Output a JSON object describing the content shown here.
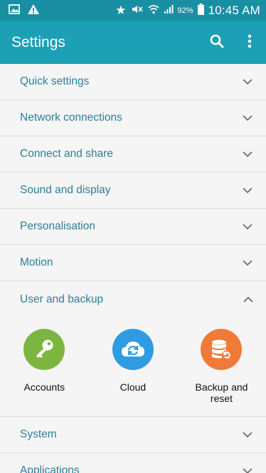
{
  "status_bar": {
    "battery_percent": "92%",
    "time": "10:45 AM"
  },
  "app_bar": {
    "title": "Settings",
    "search_icon": "search-icon",
    "more_icon": "more-vert-icon"
  },
  "settings": {
    "items_top": [
      {
        "label": "Quick settings"
      },
      {
        "label": "Network connections"
      },
      {
        "label": "Connect and share"
      },
      {
        "label": "Sound and display"
      },
      {
        "label": "Personalisation"
      },
      {
        "label": "Motion"
      }
    ],
    "expanded_section": {
      "label": "User and backup",
      "sub_items": [
        {
          "label": "Accounts",
          "icon": "key-icon",
          "color": "#7cb640"
        },
        {
          "label": "Cloud",
          "icon": "cloud-sync-icon",
          "color": "#2f9be0"
        },
        {
          "label": "Backup and reset",
          "icon": "backup-database-icon",
          "color": "#f07a38"
        }
      ]
    },
    "items_bottom": [
      {
        "label": "System"
      },
      {
        "label": "Applications"
      }
    ]
  },
  "colors": {
    "status_bar": "#1a8fa3",
    "app_bar": "#1ca0b5",
    "row_text": "#2c7f96"
  }
}
